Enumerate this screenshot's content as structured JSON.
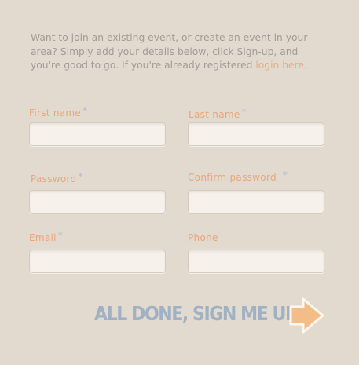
{
  "intro": {
    "text": "Want to join an existing event, or create an event in your area? Simply add your details below, click Sign-up, and you're good to go. If you're already registered ",
    "link": "login here",
    "end": "."
  },
  "form": {
    "required_mark": "*",
    "first_name": {
      "label": "First name",
      "value": ""
    },
    "last_name": {
      "label": "Last name",
      "value": ""
    },
    "password": {
      "label": "Password",
      "value": ""
    },
    "confirm_password": {
      "label": "Confirm password",
      "value": ""
    },
    "email": {
      "label": "Email",
      "value": ""
    },
    "phone": {
      "label": "Phone",
      "value": ""
    }
  },
  "submit": {
    "label": "ALL DONE, SIGN ME UP!",
    "icon": "arrow-right-icon"
  },
  "colors": {
    "background": "#e2d9cf",
    "label": "#eaa67a",
    "required": "#a9c0d8",
    "submit_text": "#9fb1c3",
    "arrow": "#f2bd86"
  }
}
